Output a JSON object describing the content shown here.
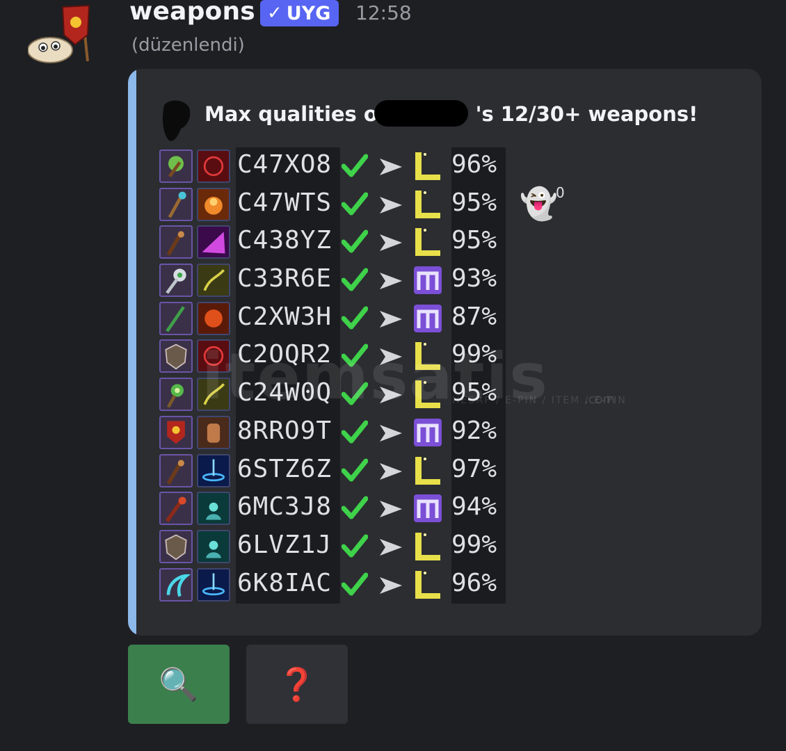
{
  "message": {
    "author": "weapons",
    "app_tag": "UYG",
    "app_tag_check": "✓",
    "timestamp": "12:58",
    "edited": "(düzenlendi)"
  },
  "embed": {
    "title_prefix": "Max qualities of ",
    "title_suffix": "'s 12/30+ weapons!",
    "accent_color": "#8cb8ea",
    "rows": [
      {
        "code": "C47XO8",
        "tier": "L",
        "percent": "96%"
      },
      {
        "code": "C47WTS",
        "tier": "L",
        "percent": "95%",
        "reaction": "👻",
        "reaction_count": "0"
      },
      {
        "code": "C438YZ",
        "tier": "L",
        "percent": "95%"
      },
      {
        "code": "C33R6E",
        "tier": "M",
        "percent": "93%"
      },
      {
        "code": "C2XW3H",
        "tier": "M",
        "percent": "87%"
      },
      {
        "code": "C2OQR2",
        "tier": "L",
        "percent": "99%"
      },
      {
        "code": "C24W0Q",
        "tier": "L",
        "percent": "95%"
      },
      {
        "code": "8RRO9T",
        "tier": "M",
        "percent": "92%"
      },
      {
        "code": "6STZ6Z",
        "tier": "L",
        "percent": "97%"
      },
      {
        "code": "6MC3J8",
        "tier": "M",
        "percent": "94%"
      },
      {
        "code": "6LVZ1J",
        "tier": "L",
        "percent": "99%"
      },
      {
        "code": "6K8IAC",
        "tier": "L",
        "percent": "96%"
      }
    ]
  },
  "watermark": {
    "text": "itemsatis",
    "sub": "HESAP / E-PIN / ITEM / E-PIN",
    "com": ".com"
  },
  "buttons": {
    "search_icon": "🔍",
    "help_icon": "❓"
  },
  "colors": {
    "legendary": "#e8e04a",
    "mythic": "#7b4fd6",
    "check": "#3fd24a",
    "button_green": "#3b7f4d",
    "tag": "#5865f2"
  }
}
